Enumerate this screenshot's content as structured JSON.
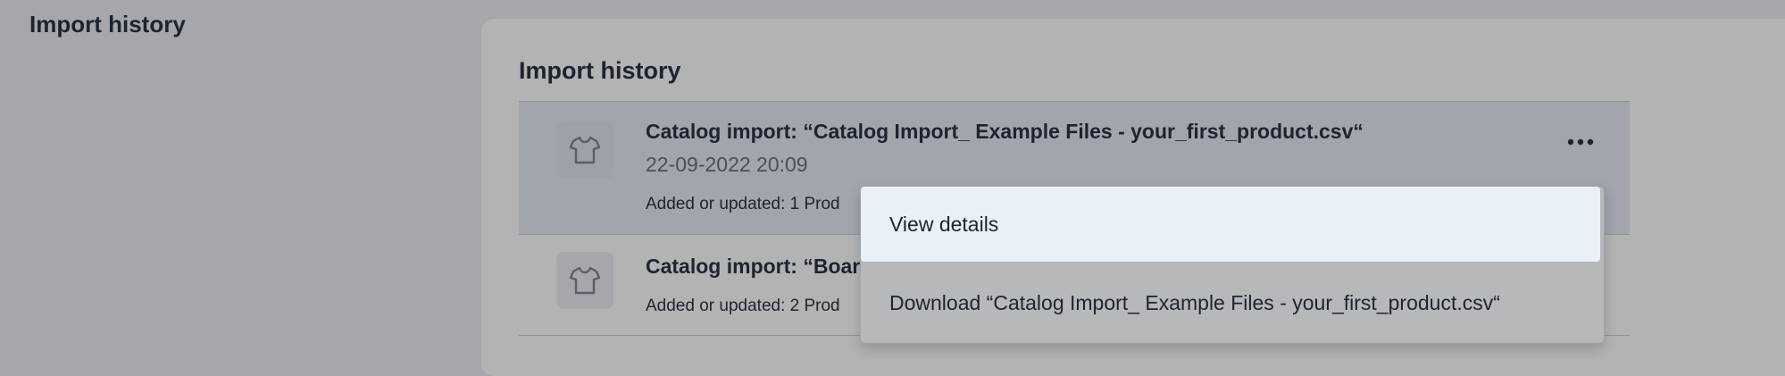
{
  "page": {
    "title": "Import history"
  },
  "card": {
    "title": "Import history"
  },
  "imports": [
    {
      "title": "Catalog import: “Catalog Import_ Example Files - your_first_product.csv“",
      "date": "22-09-2022 20:09",
      "summary": "Added or updated: 1 Prod",
      "icon": "tshirt-icon"
    },
    {
      "title": "Catalog import: “Board",
      "summary": "Added or updated: 2 Prod",
      "icon": "tshirt-icon"
    }
  ],
  "row_menu": {
    "trigger_icon": "more-horizontal-icon",
    "items": [
      {
        "label": "View details"
      },
      {
        "label": "Download “Catalog Import_ Example Files - your_first_product.csv“"
      }
    ]
  }
}
